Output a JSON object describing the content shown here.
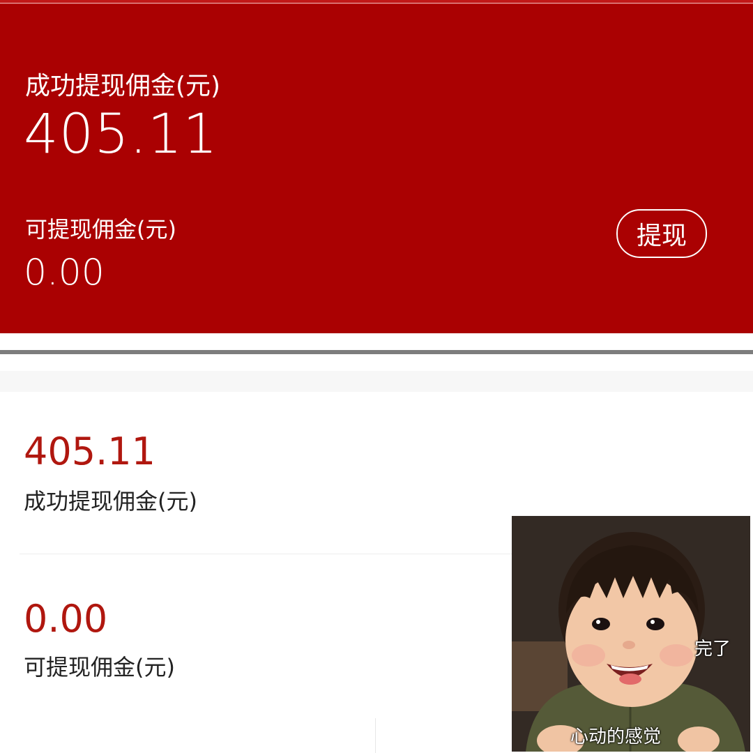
{
  "summary_card": {
    "success_label": "成功提现佣金(元)",
    "success_value": "405.11",
    "available_label": "可提现佣金(元)",
    "available_value": "0.00",
    "withdraw_button": "提现"
  },
  "stats": {
    "success_value": "405.11",
    "success_label": "成功提现佣金(元)",
    "available_value": "0.00",
    "available_label": "可提现佣金(元)"
  },
  "meme": {
    "caption_top": "完了",
    "caption_bottom": "心动的感觉"
  },
  "colors": {
    "card_red": "#aa0102",
    "value_red": "#b0170f"
  }
}
